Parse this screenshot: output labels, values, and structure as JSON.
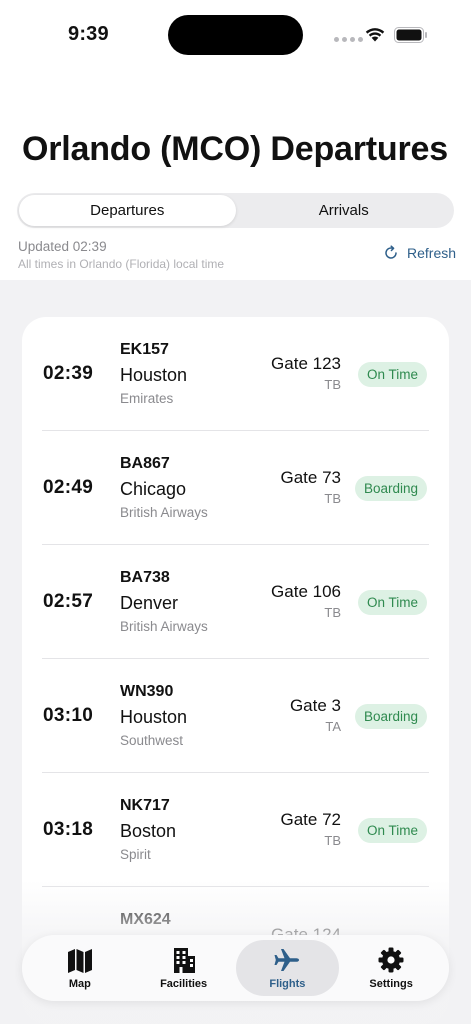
{
  "status_bar": {
    "time": "9:39"
  },
  "header": {
    "title": "Orlando (MCO) Departures"
  },
  "segments": [
    {
      "label": "Departures",
      "selected": true
    },
    {
      "label": "Arrivals",
      "selected": false
    }
  ],
  "info": {
    "updated": "Updated 02:39",
    "timezone_note": "All times in Orlando (Florida) local time",
    "refresh_label": "Refresh"
  },
  "colors": {
    "accent": "#2e5f8a",
    "status_bg": "#ddf1e4",
    "status_text": "#2f8a4f"
  },
  "flights": [
    {
      "time": "02:39",
      "flight": "EK157",
      "city": "Houston",
      "airline": "Emirates",
      "gate": "Gate 123",
      "terminal": "TB",
      "status": "On Time"
    },
    {
      "time": "02:49",
      "flight": "BA867",
      "city": "Chicago",
      "airline": "British Airways",
      "gate": "Gate 73",
      "terminal": "TB",
      "status": "Boarding"
    },
    {
      "time": "02:57",
      "flight": "BA738",
      "city": "Denver",
      "airline": "British Airways",
      "gate": "Gate 106",
      "terminal": "TB",
      "status": "On Time"
    },
    {
      "time": "03:10",
      "flight": "WN390",
      "city": "Houston",
      "airline": "Southwest",
      "gate": "Gate 3",
      "terminal": "TA",
      "status": "Boarding"
    },
    {
      "time": "03:18",
      "flight": "NK717",
      "city": "Boston",
      "airline": "Spirit",
      "gate": "Gate 72",
      "terminal": "TB",
      "status": "On Time"
    },
    {
      "time": "",
      "flight": "MX624",
      "city": "",
      "airline": "",
      "gate": "Gate 124",
      "terminal": "",
      "status": ""
    }
  ],
  "tabs": [
    {
      "label": "Map",
      "icon": "map-icon",
      "selected": false
    },
    {
      "label": "Facilities",
      "icon": "building-icon",
      "selected": false
    },
    {
      "label": "Flights",
      "icon": "airplane-icon",
      "selected": true
    },
    {
      "label": "Settings",
      "icon": "gear-icon",
      "selected": false
    }
  ]
}
